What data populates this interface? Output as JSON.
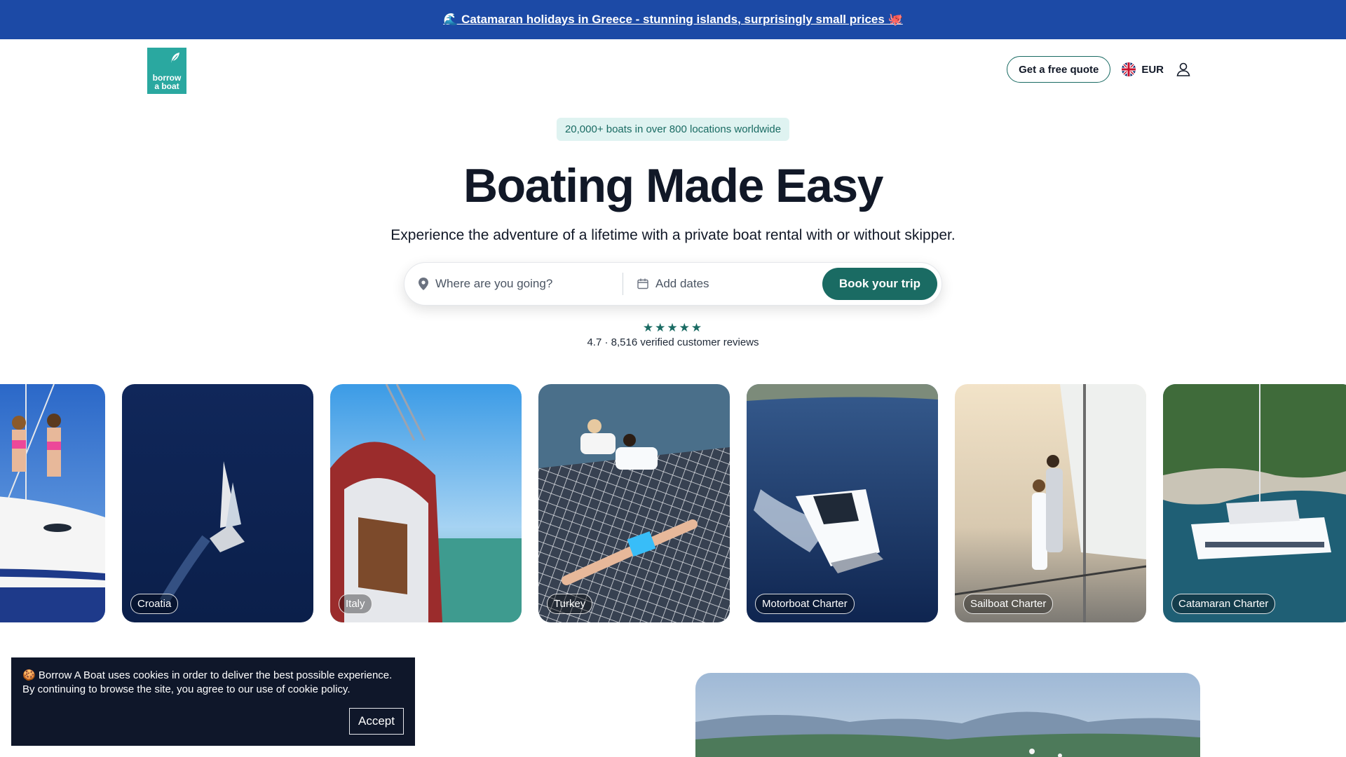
{
  "promo": {
    "text": "🌊 Catamaran holidays in Greece - stunning islands, surprisingly small prices 🐙"
  },
  "header": {
    "logo_line1": "borrow",
    "logo_line2": "a boat",
    "quote_label": "Get a free quote",
    "currency": "EUR",
    "icons": [
      "feather-icon",
      "uk-flag-icon",
      "user-icon"
    ]
  },
  "hero": {
    "badge": "20,000+ boats in over 800 locations worldwide",
    "title": "Boating Made Easy",
    "subtitle": "Experience the adventure of a lifetime with a private boat rental with or without skipper."
  },
  "search": {
    "where_placeholder": "Where are you going?",
    "dates_placeholder": "Add dates",
    "book_label": "Book your trip",
    "icons": [
      "location-pin-icon",
      "calendar-icon"
    ]
  },
  "rating": {
    "stars": "★★★★★",
    "text": "4.7 · 8,516 verified customer reviews"
  },
  "cards": [
    {
      "label": "",
      "image": "people-dancing-on-sailboat"
    },
    {
      "label": "Croatia",
      "image": "sailboat-on-deep-blue-sea"
    },
    {
      "label": "Italy",
      "image": "sailboat-deck-and-sea"
    },
    {
      "label": "Turkey",
      "image": "people-relaxing-on-catamaran-net"
    },
    {
      "label": "Motorboat Charter",
      "image": "speedboat-on-sea"
    },
    {
      "label": "Sailboat Charter",
      "image": "couple-on-sailboat-at-sunset"
    },
    {
      "label": "Catamaran Charter",
      "image": "catamaran-near-rocky-coast"
    }
  ],
  "cookie": {
    "text": "🍪 Borrow A Boat uses cookies in order to deliver the best possible experience. By continuing to browse the site, you agree to our use of cookie policy.",
    "accept_label": "Accept"
  },
  "colors": {
    "promo_bg": "#1c4aa6",
    "brand_teal": "#1a6b63",
    "logo_teal": "#2aa8a0",
    "cookie_bg": "#0f172a"
  }
}
